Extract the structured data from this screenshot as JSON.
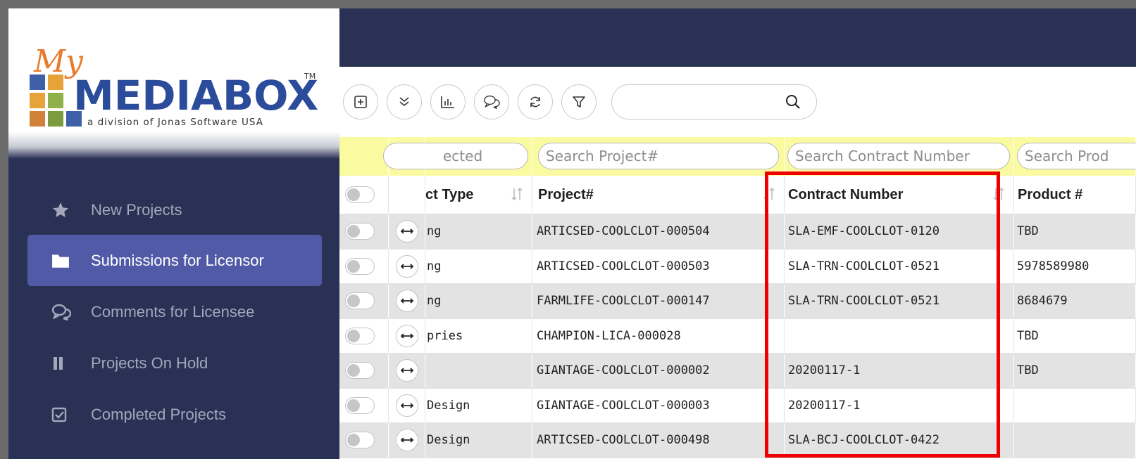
{
  "app": {
    "logo_brand": "MEDIABOX",
    "logo_prefix": "My",
    "logo_tm": "TM",
    "logo_tagline": "a division of Jonas Software USA"
  },
  "sidebar": {
    "items": [
      {
        "label": "New Projects",
        "icon": "star-icon",
        "active": false
      },
      {
        "label": "Submissions for Licensor",
        "icon": "folder-icon",
        "active": true
      },
      {
        "label": "Comments for Licensee",
        "icon": "comments-icon",
        "active": false
      },
      {
        "label": "Projects On Hold",
        "icon": "pause-icon",
        "active": false
      },
      {
        "label": "Completed Projects",
        "icon": "checkbox-icon",
        "active": false
      }
    ]
  },
  "toolbar": {
    "buttons": [
      "add-icon",
      "expand-all-icon",
      "chart-icon",
      "comments-icon",
      "refresh-icon",
      "filter-icon"
    ],
    "search_value": ""
  },
  "grid": {
    "filters": {
      "col_type": "ected",
      "project": "Search Project#",
      "contract": "Search Contract Number",
      "product": "Search Prod"
    },
    "headers": {
      "type": "ct Type",
      "project": "Project#",
      "contract": "Contract Number",
      "product": "Product #"
    },
    "rows": [
      {
        "type": "ng",
        "project": "ARTICSED-COOLCLOT-000504",
        "contract": "SLA-EMF-COOLCLOT-0120",
        "product": "TBD"
      },
      {
        "type": "ng",
        "project": "ARTICSED-COOLCLOT-000503",
        "contract": "SLA-TRN-COOLCLOT-0521",
        "product": "5978589980"
      },
      {
        "type": "ng",
        "project": "FARMLIFE-COOLCLOT-000147",
        "contract": "SLA-TRN-COOLCLOT-0521",
        "product": "8684679"
      },
      {
        "type": "pries",
        "project": "CHAMPION-LICA-000028",
        "contract": "",
        "product": "TBD"
      },
      {
        "type": "",
        "project": "GIANTAGE-COOLCLOT-000002",
        "contract": "20200117-1",
        "product": "TBD"
      },
      {
        "type": "Design",
        "project": "GIANTAGE-COOLCLOT-000003",
        "contract": "20200117-1",
        "product": ""
      },
      {
        "type": "Design",
        "project": "ARTICSED-COOLCLOT-000498",
        "contract": "SLA-BCJ-COOLCLOT-0422",
        "product": ""
      }
    ]
  },
  "colors": {
    "sidebar_bg": "#293154",
    "active_item": "#515aa6",
    "filter_row": "#fafaa0",
    "highlight": "#ee0000"
  }
}
